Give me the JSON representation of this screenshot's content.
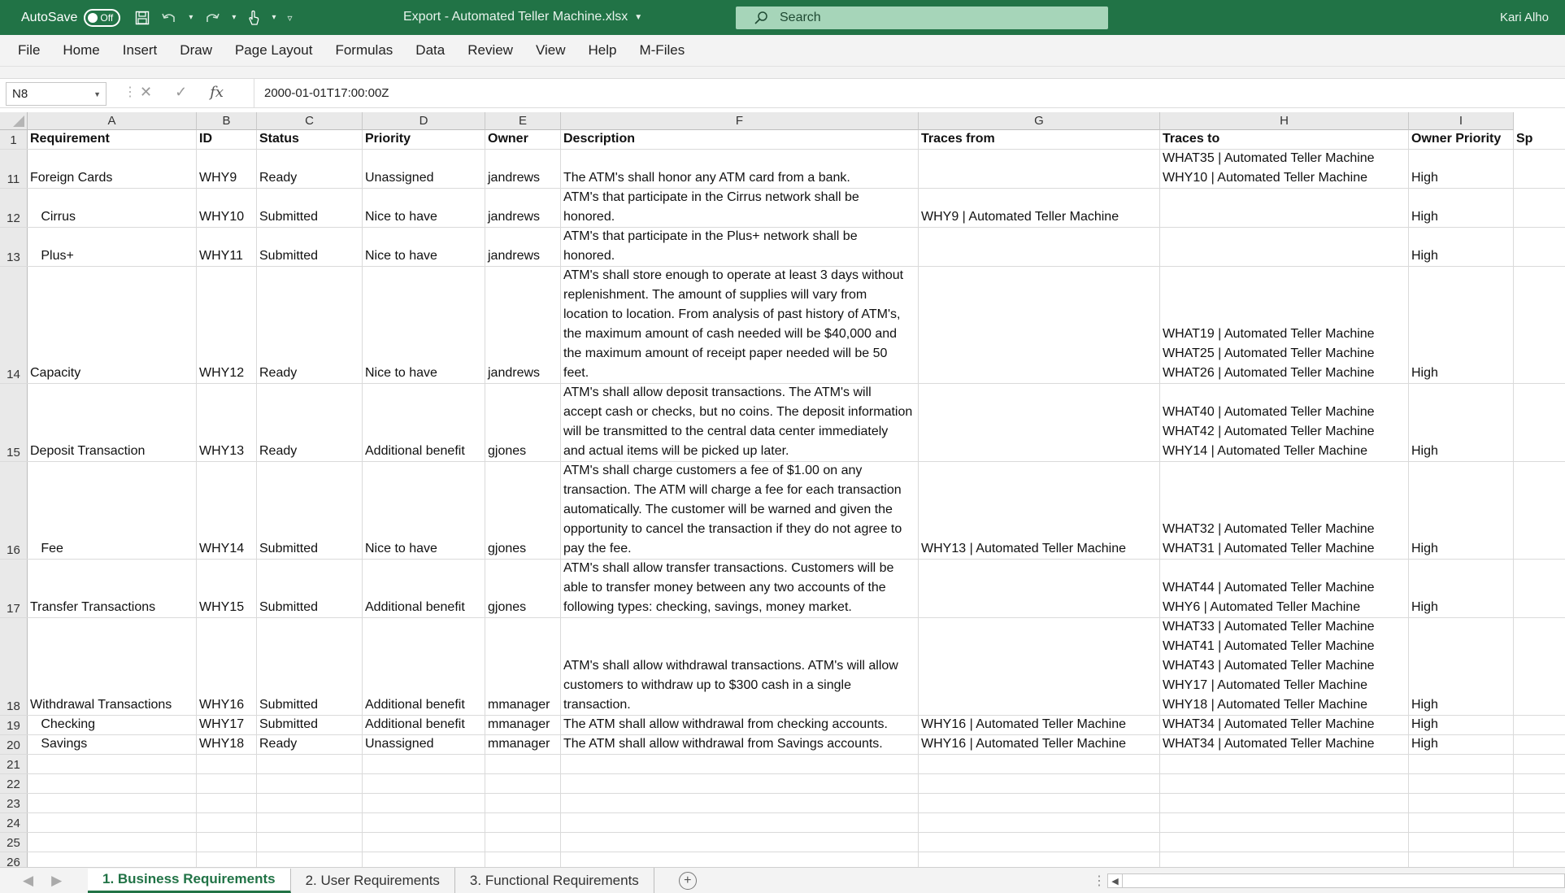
{
  "titlebar": {
    "autosave_label": "AutoSave",
    "autosave_state": "Off",
    "doc_title": "Export - Automated Teller Machine.xlsx",
    "search_placeholder": "Search",
    "user_name": "Kari Alho"
  },
  "menu": [
    "File",
    "Home",
    "Insert",
    "Draw",
    "Page Layout",
    "Formulas",
    "Data",
    "Review",
    "View",
    "Help",
    "M-Files"
  ],
  "formula_bar": {
    "name_box": "N8",
    "formula": "2000-01-01T17:00:00Z"
  },
  "columns": [
    "A",
    "B",
    "C",
    "D",
    "E",
    "F",
    "G",
    "H",
    "I"
  ],
  "header_row": {
    "row_num": "1",
    "cells": [
      "Requirement",
      "ID",
      "Status",
      "Priority",
      "Owner",
      "Description",
      "Traces from",
      "Traces to",
      "Owner Priority",
      "Sp"
    ]
  },
  "rows": [
    {
      "row_num": "11",
      "requirement": "Foreign Cards",
      "id": "WHY9",
      "status": "Ready",
      "priority": "Unassigned",
      "owner": "jandrews",
      "description": [
        "The ATM's shall honor any ATM card from a bank."
      ],
      "traces_from": [],
      "traces_to": [
        "WHAT35 | Automated Teller Machine",
        "WHY10 | Automated Teller Machine"
      ],
      "owner_priority": "High"
    },
    {
      "row_num": "12",
      "requirement": "   Cirrus",
      "id": "WHY10",
      "status": "Submitted",
      "priority": "Nice to have",
      "owner": "jandrews",
      "description": [
        "ATM's that participate in the Cirrus network shall be",
        "honored."
      ],
      "traces_from": [
        "WHY9 | Automated Teller Machine"
      ],
      "traces_to": [],
      "owner_priority": "High"
    },
    {
      "row_num": "13",
      "requirement": "   Plus+",
      "id": "WHY11",
      "status": "Submitted",
      "priority": "Nice to have",
      "owner": "jandrews",
      "description": [
        "ATM's that participate in the Plus+ network shall be",
        "honored."
      ],
      "traces_from": [],
      "traces_to": [],
      "owner_priority": "High"
    },
    {
      "row_num": "14",
      "requirement": "Capacity",
      "id": "WHY12",
      "status": "Ready",
      "priority": "Nice to have",
      "owner": "jandrews",
      "description": [
        "ATM's shall store enough to operate at least 3 days without",
        "replenishment. The amount of supplies will vary from",
        "location to location. From analysis of past history of ATM's,",
        "the maximum amount of cash needed will be $40,000 and",
        "the maximum amount of receipt paper needed will be 50",
        "feet."
      ],
      "traces_from": [],
      "traces_to": [
        "WHAT19 | Automated Teller Machine",
        "WHAT25 | Automated Teller Machine",
        "WHAT26 | Automated Teller Machine"
      ],
      "owner_priority": "High"
    },
    {
      "row_num": "15",
      "requirement": "Deposit Transaction",
      "id": "WHY13",
      "status": "Ready",
      "priority": "Additional benefit",
      "owner": "gjones",
      "description": [
        "ATM's shall allow deposit transactions. The ATM's will",
        "accept cash or checks, but no coins. The deposit information",
        "will be transmitted to the central data center immediately",
        "and actual items will be picked up later."
      ],
      "traces_from": [],
      "traces_to": [
        "WHAT40 | Automated Teller Machine",
        "WHAT42 | Automated Teller Machine",
        "WHY14 | Automated Teller Machine"
      ],
      "owner_priority": "High"
    },
    {
      "row_num": "16",
      "requirement": "   Fee",
      "id": "WHY14",
      "status": "Submitted",
      "priority": "Nice to have",
      "owner": "gjones",
      "description": [
        "ATM's shall charge customers a fee of $1.00 on any",
        "transaction. The ATM will charge a fee for each transaction",
        "automatically. The customer will be warned and given the",
        "opportunity to cancel the transaction if they do not agree to",
        "pay the fee."
      ],
      "traces_from": [
        "WHY13 | Automated Teller Machine"
      ],
      "traces_to": [
        "WHAT32 | Automated Teller Machine",
        "WHAT31 | Automated Teller Machine"
      ],
      "owner_priority": "High"
    },
    {
      "row_num": "17",
      "requirement": "Transfer Transactions",
      "id": "WHY15",
      "status": "Submitted",
      "priority": "Additional benefit",
      "owner": "gjones",
      "description": [
        "ATM's shall allow transfer transactions. Customers will be",
        "able to transfer money between any two accounts of the",
        "following types: checking, savings, money market."
      ],
      "traces_from": [],
      "traces_to": [
        "WHAT44 | Automated Teller Machine",
        "WHY6 | Automated Teller Machine"
      ],
      "owner_priority": "High"
    },
    {
      "row_num": "18",
      "requirement": "Withdrawal Transactions",
      "id": "WHY16",
      "status": "Submitted",
      "priority": "Additional benefit",
      "owner": "mmanager",
      "description": [
        "ATM's shall allow withdrawal transactions. ATM's will allow",
        "customers to withdraw up to $300 cash in a single",
        "transaction."
      ],
      "traces_from": [],
      "traces_to": [
        "WHAT33 | Automated Teller Machine",
        "WHAT41 | Automated Teller Machine",
        "WHAT43 | Automated Teller Machine",
        "WHY17 | Automated Teller Machine",
        "WHY18 | Automated Teller Machine"
      ],
      "owner_priority": "High"
    },
    {
      "row_num": "19",
      "requirement": "   Checking",
      "id": "WHY17",
      "status": "Submitted",
      "priority": "Additional benefit",
      "owner": "mmanager",
      "description": [
        "The ATM shall allow withdrawal from checking accounts."
      ],
      "traces_from": [
        "WHY16 | Automated Teller Machine"
      ],
      "traces_to": [
        "WHAT34 | Automated Teller Machine"
      ],
      "owner_priority": "High"
    },
    {
      "row_num": "20",
      "requirement": "   Savings",
      "id": "WHY18",
      "status": "Ready",
      "priority": "Unassigned",
      "owner": "mmanager",
      "description": [
        "The ATM shall allow withdrawal from Savings accounts."
      ],
      "traces_from": [
        "WHY16 | Automated Teller Machine"
      ],
      "traces_to": [
        "WHAT34 | Automated Teller Machine"
      ],
      "owner_priority": "High"
    }
  ],
  "empty_rows": [
    "21",
    "22",
    "23",
    "24",
    "25",
    "26"
  ],
  "sheet_tabs": [
    "1. Business Requirements",
    "2. User Requirements",
    "3. Functional Requirements"
  ],
  "active_tab": 0,
  "colors": {
    "excel_green": "#217346",
    "search_bg": "#a6d5b9"
  }
}
